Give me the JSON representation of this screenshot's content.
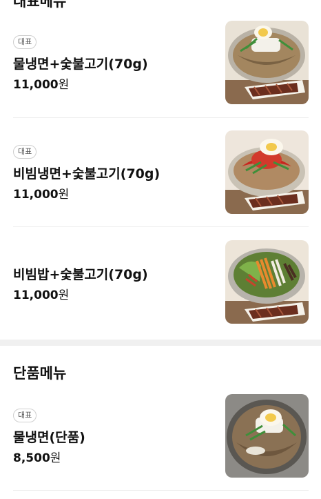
{
  "sections": [
    {
      "title": "대표메뉴",
      "items": [
        {
          "badge": "대표",
          "name": "물냉면+숯불고기(70g)",
          "price": "11,000",
          "won": "원",
          "image": "mul-naengmyeon-bulgogi-photo"
        },
        {
          "badge": "대표",
          "name": "비빔냉면+숯불고기(70g)",
          "price": "11,000",
          "won": "원",
          "image": "bibim-naengmyeon-bulgogi-photo"
        },
        {
          "badge": "",
          "name": "비빔밥+숯불고기(70g)",
          "price": "11,000",
          "won": "원",
          "image": "bibimbap-bulgogi-photo"
        }
      ]
    },
    {
      "title": "단품메뉴",
      "items": [
        {
          "badge": "대표",
          "name": "물냉면(단품)",
          "price": "8,500",
          "won": "원",
          "image": "mul-naengmyeon-photo"
        }
      ]
    }
  ],
  "colors": {
    "divider": "#eeeeee",
    "section_gap": "#f0f0f0",
    "badge_border": "#cfcfcf"
  }
}
